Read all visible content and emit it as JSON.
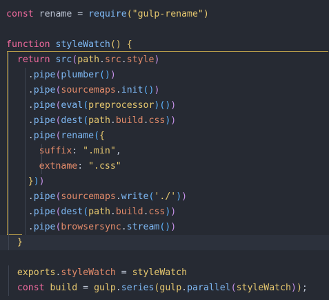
{
  "code_lines": [
    [
      {
        "t": "const ",
        "c": "k"
      },
      {
        "t": "rename",
        "c": "v"
      },
      {
        "t": " = ",
        "c": "pu"
      },
      {
        "t": "require",
        "c": "f"
      },
      {
        "t": "(",
        "c": "y"
      },
      {
        "t": "\"gulp-rename\"",
        "c": "s"
      },
      {
        "t": ")",
        "c": "y"
      }
    ],
    [],
    [
      {
        "t": "function ",
        "c": "k"
      },
      {
        "t": "styleWatch",
        "c": "f"
      },
      {
        "t": "()",
        "c": "y"
      },
      {
        "t": " ",
        "c": "pu"
      },
      {
        "t": "{",
        "c": "y"
      }
    ],
    [
      {
        "t": "  ",
        "c": "pu"
      },
      {
        "t": "return ",
        "c": "k"
      },
      {
        "t": "src",
        "c": "f"
      },
      {
        "t": "(",
        "c": "m"
      },
      {
        "t": "path",
        "c": "t"
      },
      {
        "t": ".",
        "c": "pu"
      },
      {
        "t": "src",
        "c": "p"
      },
      {
        "t": ".",
        "c": "pu"
      },
      {
        "t": "style",
        "c": "p"
      },
      {
        "t": ")",
        "c": "m"
      }
    ],
    [
      {
        "t": "    .",
        "c": "pu"
      },
      {
        "t": "pipe",
        "c": "f"
      },
      {
        "t": "(",
        "c": "m"
      },
      {
        "t": "plumber",
        "c": "f"
      },
      {
        "t": "()",
        "c": "b"
      },
      {
        "t": ")",
        "c": "m"
      }
    ],
    [
      {
        "t": "    .",
        "c": "pu"
      },
      {
        "t": "pipe",
        "c": "f"
      },
      {
        "t": "(",
        "c": "m"
      },
      {
        "t": "sourcemaps",
        "c": "p"
      },
      {
        "t": ".",
        "c": "pu"
      },
      {
        "t": "init",
        "c": "f"
      },
      {
        "t": "()",
        "c": "b"
      },
      {
        "t": ")",
        "c": "m"
      }
    ],
    [
      {
        "t": "    .",
        "c": "pu"
      },
      {
        "t": "pipe",
        "c": "f"
      },
      {
        "t": "(",
        "c": "m"
      },
      {
        "t": "eval",
        "c": "f"
      },
      {
        "t": "(",
        "c": "b"
      },
      {
        "t": "preprocessor",
        "c": "t"
      },
      {
        "t": ")",
        "c": "b"
      },
      {
        "t": "()",
        "c": "b"
      },
      {
        "t": ")",
        "c": "m"
      }
    ],
    [
      {
        "t": "    .",
        "c": "pu"
      },
      {
        "t": "pipe",
        "c": "f"
      },
      {
        "t": "(",
        "c": "m"
      },
      {
        "t": "dest",
        "c": "f"
      },
      {
        "t": "(",
        "c": "b"
      },
      {
        "t": "path",
        "c": "t"
      },
      {
        "t": ".",
        "c": "pu"
      },
      {
        "t": "build",
        "c": "p"
      },
      {
        "t": ".",
        "c": "pu"
      },
      {
        "t": "css",
        "c": "p"
      },
      {
        "t": ")",
        "c": "b"
      },
      {
        "t": ")",
        "c": "m"
      }
    ],
    [
      {
        "t": "    .",
        "c": "pu"
      },
      {
        "t": "pipe",
        "c": "f"
      },
      {
        "t": "(",
        "c": "m"
      },
      {
        "t": "rename",
        "c": "f"
      },
      {
        "t": "(",
        "c": "b"
      },
      {
        "t": "{",
        "c": "y"
      }
    ],
    [
      {
        "t": "      ",
        "c": "pu"
      },
      {
        "t": "suffix",
        "c": "p"
      },
      {
        "t": ": ",
        "c": "pu"
      },
      {
        "t": "\".min\"",
        "c": "s"
      },
      {
        "t": ",",
        "c": "pu"
      }
    ],
    [
      {
        "t": "      ",
        "c": "pu"
      },
      {
        "t": "extname",
        "c": "p"
      },
      {
        "t": ": ",
        "c": "pu"
      },
      {
        "t": "\".css\"",
        "c": "s"
      }
    ],
    [
      {
        "t": "    ",
        "c": "pu"
      },
      {
        "t": "}",
        "c": "y"
      },
      {
        "t": ")",
        "c": "b"
      },
      {
        "t": ")",
        "c": "m"
      }
    ],
    [
      {
        "t": "    .",
        "c": "pu"
      },
      {
        "t": "pipe",
        "c": "f"
      },
      {
        "t": "(",
        "c": "m"
      },
      {
        "t": "sourcemaps",
        "c": "p"
      },
      {
        "t": ".",
        "c": "pu"
      },
      {
        "t": "write",
        "c": "f"
      },
      {
        "t": "(",
        "c": "b"
      },
      {
        "t": "'./'",
        "c": "s"
      },
      {
        "t": ")",
        "c": "b"
      },
      {
        "t": ")",
        "c": "m"
      }
    ],
    [
      {
        "t": "    .",
        "c": "pu"
      },
      {
        "t": "pipe",
        "c": "f"
      },
      {
        "t": "(",
        "c": "m"
      },
      {
        "t": "dest",
        "c": "f"
      },
      {
        "t": "(",
        "c": "b"
      },
      {
        "t": "path",
        "c": "t"
      },
      {
        "t": ".",
        "c": "pu"
      },
      {
        "t": "build",
        "c": "p"
      },
      {
        "t": ".",
        "c": "pu"
      },
      {
        "t": "css",
        "c": "p"
      },
      {
        "t": ")",
        "c": "b"
      },
      {
        "t": ")",
        "c": "m"
      }
    ],
    [
      {
        "t": "    .",
        "c": "pu"
      },
      {
        "t": "pipe",
        "c": "f"
      },
      {
        "t": "(",
        "c": "m"
      },
      {
        "t": "browsersync",
        "c": "p"
      },
      {
        "t": ".",
        "c": "pu"
      },
      {
        "t": "stream",
        "c": "f"
      },
      {
        "t": "()",
        "c": "b"
      },
      {
        "t": ")",
        "c": "m"
      }
    ],
    [
      {
        "t": "  ",
        "c": "pu"
      },
      {
        "t": "}",
        "c": "y"
      }
    ],
    [],
    [
      {
        "t": "  ",
        "c": "pu"
      },
      {
        "t": "exports",
        "c": "t"
      },
      {
        "t": ".",
        "c": "pu"
      },
      {
        "t": "styleWatch",
        "c": "p"
      },
      {
        "t": " = ",
        "c": "pu"
      },
      {
        "t": "styleWatch",
        "c": "t"
      }
    ],
    [
      {
        "t": "  ",
        "c": "pu"
      },
      {
        "t": "const ",
        "c": "k"
      },
      {
        "t": "build",
        "c": "t"
      },
      {
        "t": " = ",
        "c": "pu"
      },
      {
        "t": "gulp",
        "c": "t"
      },
      {
        "t": ".",
        "c": "pu"
      },
      {
        "t": "series",
        "c": "f"
      },
      {
        "t": "(",
        "c": "y"
      },
      {
        "t": "gulp",
        "c": "t"
      },
      {
        "t": ".",
        "c": "pu"
      },
      {
        "t": "parallel",
        "c": "f"
      },
      {
        "t": "(",
        "c": "m"
      },
      {
        "t": "styleWatch",
        "c": "t"
      },
      {
        "t": ")",
        "c": "m"
      },
      {
        "t": ")",
        "c": "y"
      },
      {
        "t": ";",
        "c": "pu"
      }
    ]
  ]
}
